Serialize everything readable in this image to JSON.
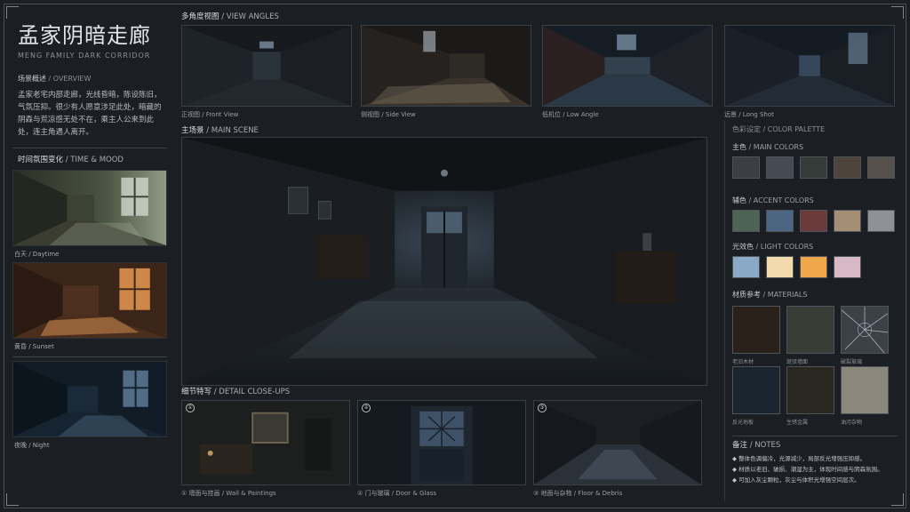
{
  "header": {
    "title": "孟家阴暗走廊",
    "subtitle": "MENG FAMILY DARK CORRIDOR"
  },
  "overview": {
    "label_cn": "场景概述",
    "label_en": "/ OVERVIEW",
    "text": "孟家老宅内部走廊，光线昏暗，陈设陈旧，气氛压抑。很少有人愿意涉足此处，暗藏的阴森与荒凉感无处不在，乘主人公来到此处，连主角遇人离开。"
  },
  "mood": {
    "label_cn": "时间氛围变化",
    "label_en": "/ TIME & MOOD",
    "items": [
      {
        "caption": "白天 / Daytime"
      },
      {
        "caption": "黄昏 / Sunset"
      },
      {
        "caption": "夜晚 / Night"
      }
    ]
  },
  "views": {
    "label_cn": "多角度视图",
    "label_en": "/ VIEW ANGLES",
    "items": [
      {
        "caption": "正视图 / Front View"
      },
      {
        "caption": "侧视图 / Side View"
      },
      {
        "caption": "低机位 / Low Angle"
      },
      {
        "caption": "远景 / Long Shot"
      }
    ]
  },
  "main_scene": {
    "label_cn": "主场景",
    "label_en": "/ MAIN SCENE"
  },
  "details": {
    "label_cn": "细节特写",
    "label_en": "/ DETAIL CLOSE-UPS",
    "items": [
      {
        "num": "①",
        "caption": "① 墙面与挂画 / Wall & Paintings"
      },
      {
        "num": "②",
        "caption": "② 门与玻璃 / Door & Glass"
      },
      {
        "num": "③",
        "caption": "③ 地面与杂物 / Floor & Debris"
      }
    ]
  },
  "palette": {
    "title": "色彩设定 / COLOR PALETTE",
    "main": {
      "label_cn": "主色",
      "label_en": "/ MAIN COLORS",
      "colors": [
        "#3b3f45",
        "#444b52",
        "#353b38",
        "#4d443c",
        "#56514c"
      ]
    },
    "accent": {
      "label_cn": "辅色",
      "label_en": "/ ACCENT COLORS",
      "colors": [
        "#4d6354",
        "#4c6580",
        "#6b3a3a",
        "#a48f74",
        "#8e9296"
      ]
    },
    "light": {
      "label_cn": "光效色",
      "label_en": "/ LIGHT COLORS",
      "colors": [
        "#8aa9c6",
        "#f3d9ae",
        "#efa74a",
        "#d7b9c5"
      ]
    }
  },
  "materials": {
    "label_cn": "材质参考",
    "label_en": "/ MATERIALS",
    "items": [
      {
        "caption": "老旧木材"
      },
      {
        "caption": "斑驳墙面"
      },
      {
        "caption": "破裂玻璃"
      },
      {
        "caption": "反光地板"
      },
      {
        "caption": "生锈金属"
      },
      {
        "caption": "油污杂物"
      }
    ]
  },
  "notes": {
    "label_cn": "备注",
    "label_en": "/ NOTES",
    "items": [
      "◆ 整体色调偏冷，光源减少，局部反光增强压抑感。",
      "◆ 材质以老旧、破损、潮湿为主，体现时间感与阴森氛围。",
      "◆ 可加入灰尘颗粒，灰尘与体积光增强空间层次。"
    ]
  }
}
